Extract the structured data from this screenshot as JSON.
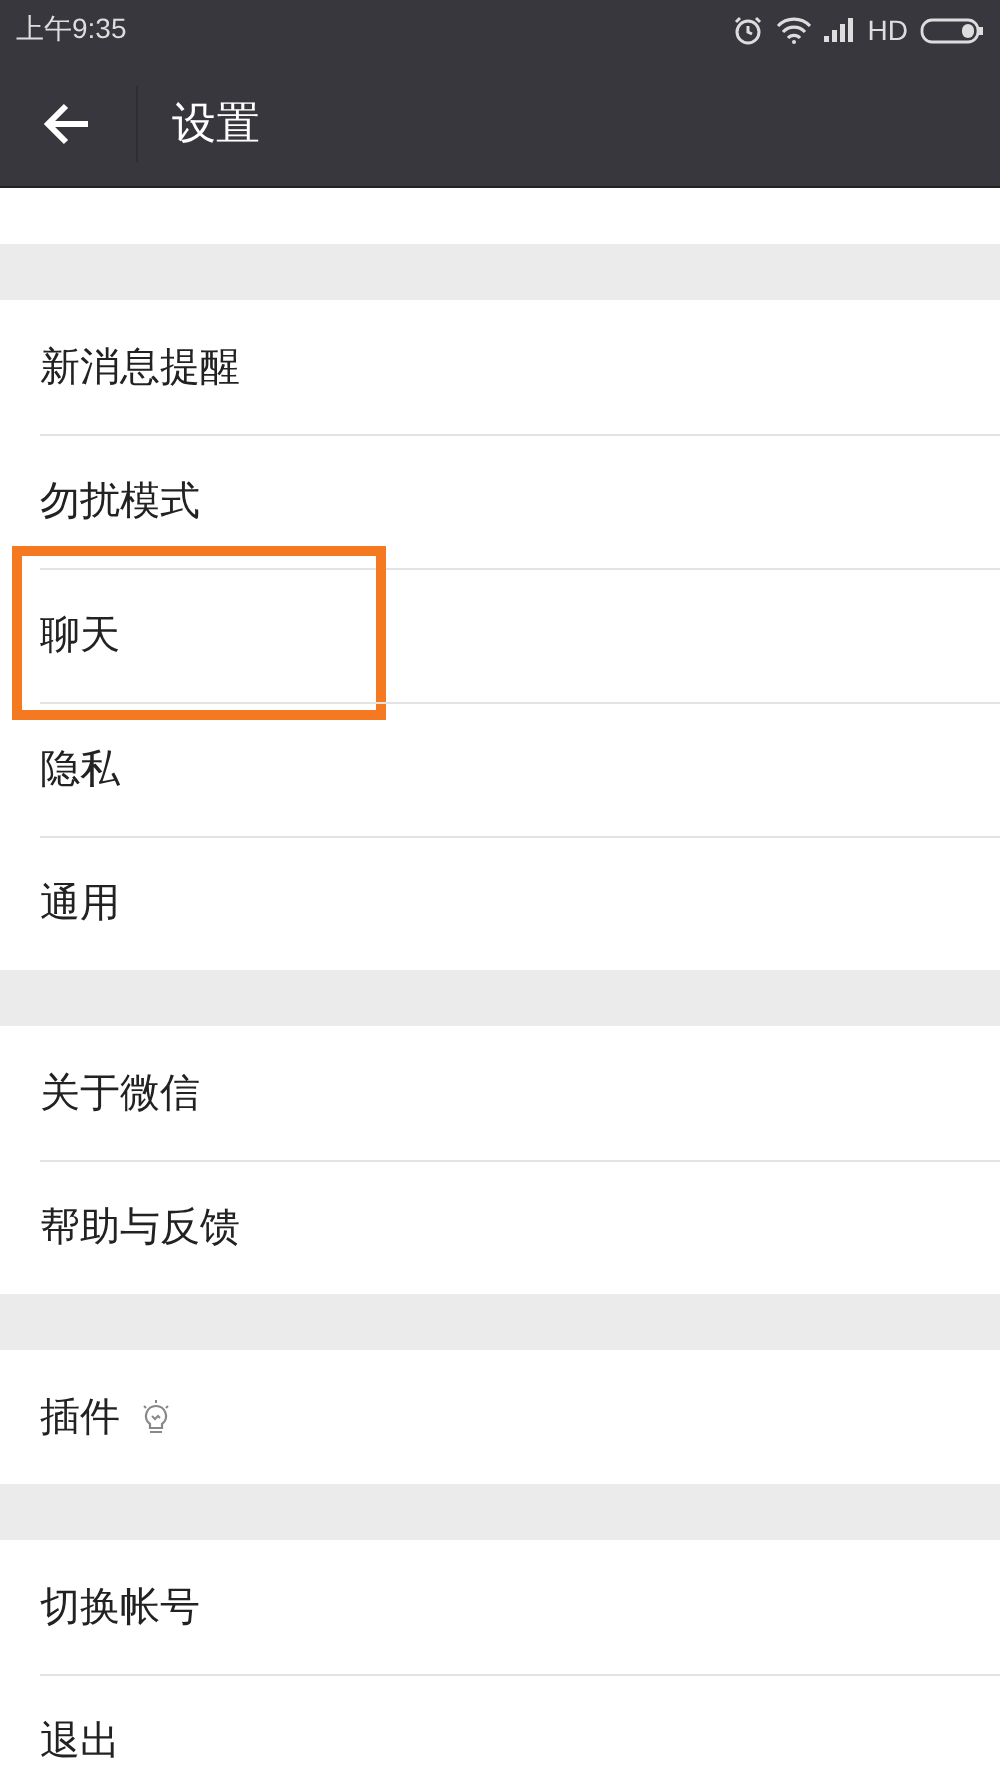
{
  "status_bar": {
    "time": "上午9:35",
    "network": "HD"
  },
  "header": {
    "back": true,
    "title": "设置"
  },
  "groups": [
    [
      {
        "label": "新消息提醒",
        "kind": "plain",
        "highlighted": false
      },
      {
        "label": "勿扰模式",
        "kind": "plain",
        "highlighted": false
      },
      {
        "label": "聊天",
        "kind": "plain",
        "highlighted": true
      },
      {
        "label": "隐私",
        "kind": "plain",
        "highlighted": false
      },
      {
        "label": "通用",
        "kind": "plain",
        "highlighted": false
      }
    ],
    [
      {
        "label": "关于微信",
        "kind": "plain",
        "highlighted": false
      },
      {
        "label": "帮助与反馈",
        "kind": "plain",
        "highlighted": false
      }
    ],
    [
      {
        "label": "插件",
        "kind": "with-icon",
        "highlighted": false
      }
    ],
    [
      {
        "label": "切换帐号",
        "kind": "plain",
        "highlighted": false
      },
      {
        "label": "退出",
        "kind": "plain",
        "highlighted": false
      }
    ]
  ]
}
